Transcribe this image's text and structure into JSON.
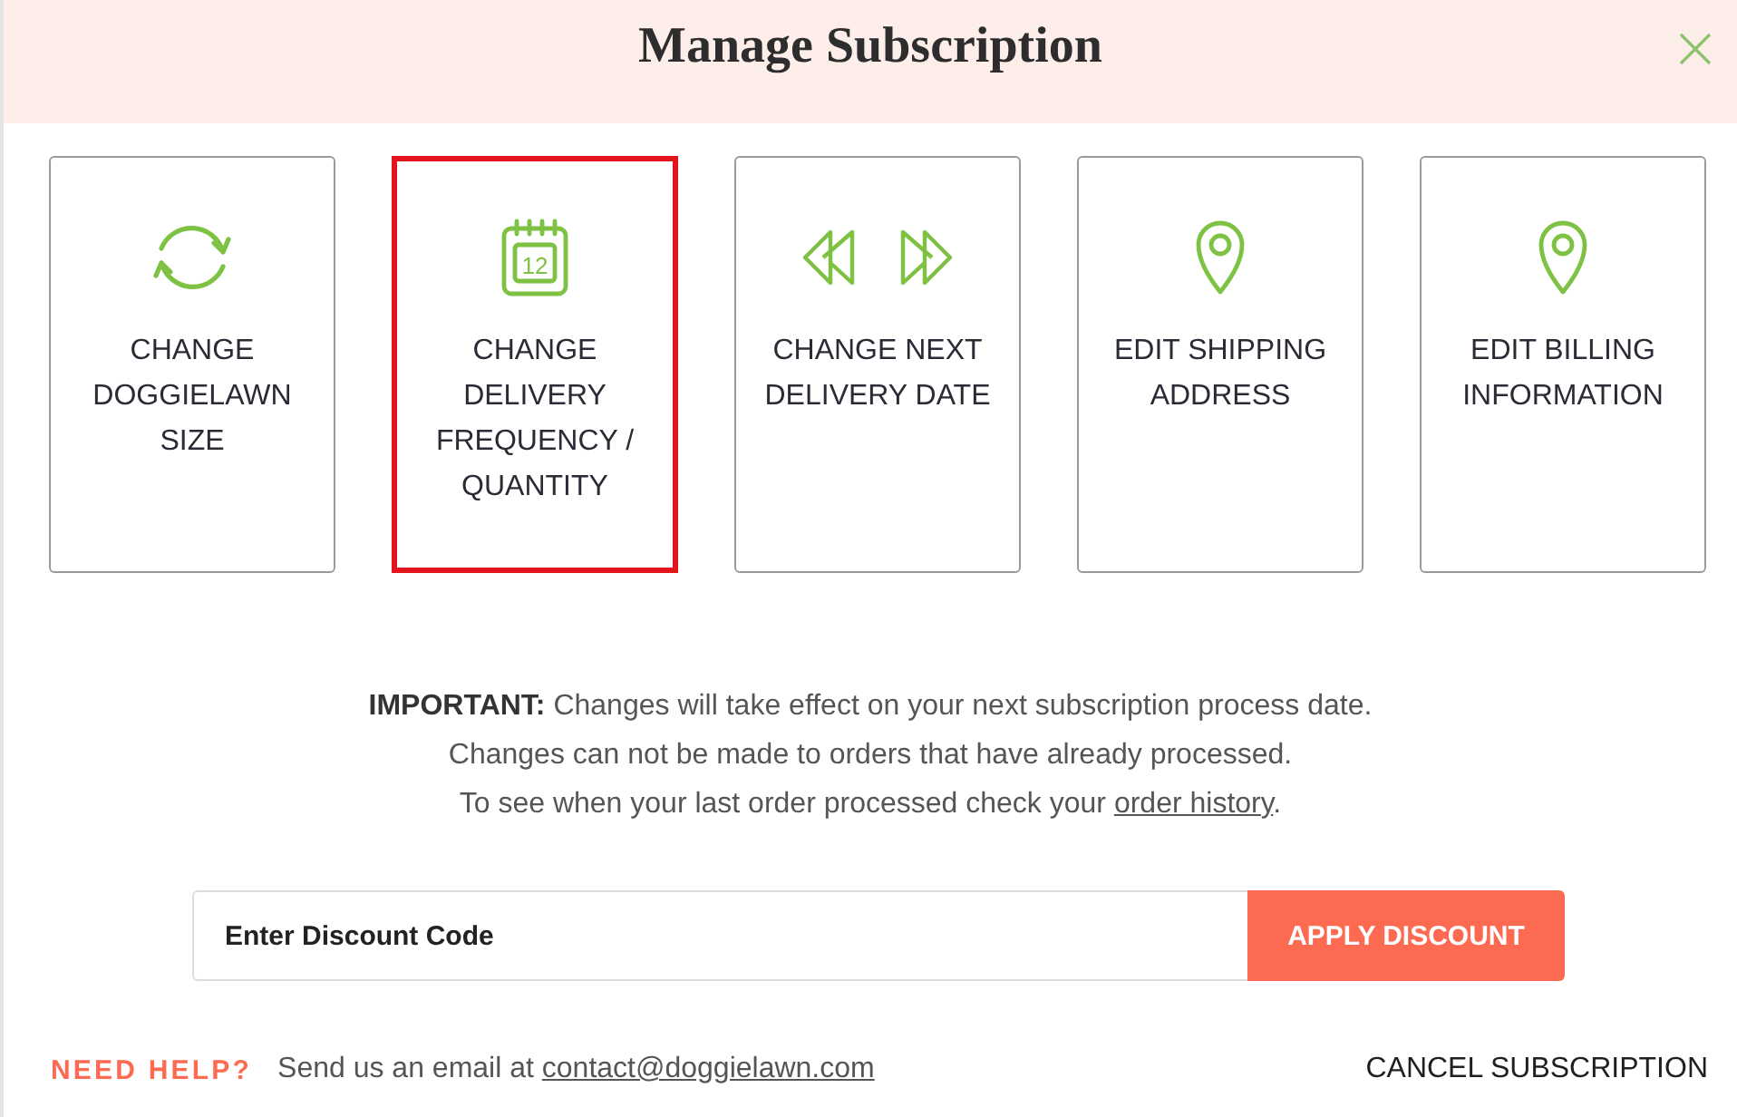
{
  "dialog": {
    "title": "Manage Subscription"
  },
  "options": [
    {
      "kind": "refresh",
      "label_lines": [
        "CHANGE",
        "DOGGIELAWN",
        "SIZE"
      ],
      "selected": false
    },
    {
      "kind": "calendar",
      "icon_text": "12",
      "label_lines": [
        "CHANGE",
        "DELIVERY",
        "FREQUENCY /",
        "QUANTITY"
      ],
      "selected": true
    },
    {
      "kind": "skip",
      "label_lines": [
        "CHANGE NEXT",
        "DELIVERY DATE"
      ],
      "selected": false
    },
    {
      "kind": "pin",
      "label_lines": [
        "EDIT SHIPPING",
        "ADDRESS"
      ],
      "selected": false
    },
    {
      "kind": "pin",
      "label_lines": [
        "EDIT BILLING",
        "INFORMATION"
      ],
      "selected": false
    }
  ],
  "notice": {
    "lines": [
      {
        "text": "**IMPORTANT:** Changes will take effect on your next subscription process date."
      },
      {
        "text": "Changes can not be made to orders that have already processed."
      },
      {
        "text": "To see when your last order processed check your",
        "link": "order history",
        "text_after": "."
      }
    ]
  },
  "discount": {
    "placeholder": "Enter Discount Code",
    "button": "APPLY DISCOUNT"
  },
  "footer": {
    "help_label": "NEED HELP?",
    "help_text": "Send us an email at",
    "email": "contact@doggielawn.com",
    "cancel": "CANCEL SUBSCRIPTION"
  }
}
